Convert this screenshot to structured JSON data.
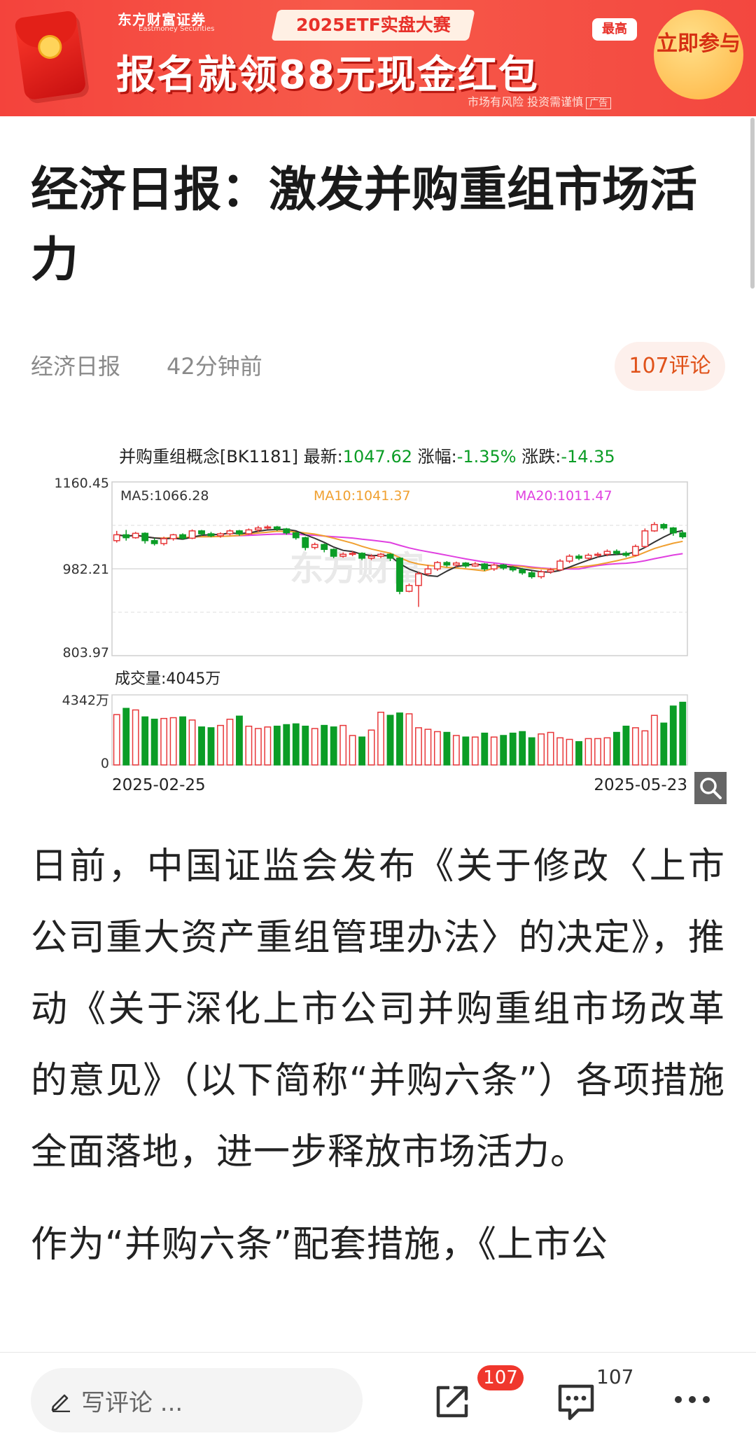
{
  "ad": {
    "brand": "东方财富证券",
    "brand_en": "Eastmoney Securities",
    "event": "2025ETF实盘大赛",
    "headline": "报名就领88元现金红包",
    "max_tag": "最高",
    "cta": "立即参与",
    "risk": "市场有风险 投资需谨慎",
    "ad_tag": "广告"
  },
  "article": {
    "title": "经济日报：激发并购重组市场活力",
    "source": "经济日报",
    "time": "42分钟前",
    "comments_label": "107评论",
    "paragraphs": [
      "日前，中国证监会发布《关于修改〈上市公司重大资产重组管理办法〉的决定》，推动《关于深化上市公司并购重组市场改革的意见》（以下简称“并购六条”）各项措施全面落地，进一步释放市场活力。",
      "作为“并购六条”配套措施，《上市公"
    ]
  },
  "chart_data": {
    "type": "candlestick",
    "header": {
      "name": "并购重组概念[BK1181]",
      "latest_label": "最新:",
      "latest": "1047.62",
      "change_pct_label": "涨幅:",
      "change_pct": "-1.35%",
      "change_label": "涨跌:",
      "change": "-14.35"
    },
    "ma": {
      "ma5": "MA5:1066.28",
      "ma10": "MA10:1041.37",
      "ma20": "MA20:1011.47"
    },
    "y_ticks": [
      "1160.45",
      "982.21",
      "803.97"
    ],
    "ylim": [
      803.97,
      1160.45
    ],
    "volume_label": "成交量:4045万",
    "volume_ticks": [
      "4342万",
      "0"
    ],
    "volume_max": 4342,
    "x_start": "2025-02-25",
    "x_end": "2025-05-23",
    "watermark": "东方财富",
    "colors": {
      "up": "#e8383a",
      "down": "#0b9d26",
      "ma5": "#333333",
      "ma10": "#f0a030",
      "ma20": "#e040e0"
    },
    "candles": [
      [
        1040,
        1052,
        1060,
        1036
      ],
      [
        1052,
        1046,
        1062,
        1040
      ],
      [
        1046,
        1055,
        1058,
        1044
      ],
      [
        1055,
        1040,
        1057,
        1034
      ],
      [
        1040,
        1034,
        1045,
        1030
      ],
      [
        1034,
        1044,
        1048,
        1030
      ],
      [
        1044,
        1052,
        1054,
        1040
      ],
      [
        1052,
        1045,
        1055,
        1042
      ],
      [
        1045,
        1060,
        1063,
        1043
      ],
      [
        1060,
        1054,
        1062,
        1050
      ],
      [
        1054,
        1050,
        1058,
        1047
      ],
      [
        1050,
        1054,
        1057,
        1046
      ],
      [
        1054,
        1060,
        1063,
        1051
      ],
      [
        1060,
        1054,
        1062,
        1050
      ],
      [
        1054,
        1062,
        1065,
        1052
      ],
      [
        1062,
        1066,
        1070,
        1058
      ],
      [
        1066,
        1068,
        1072,
        1063
      ],
      [
        1068,
        1064,
        1070,
        1060
      ],
      [
        1064,
        1056,
        1066,
        1052
      ],
      [
        1056,
        1046,
        1058,
        1042
      ],
      [
        1046,
        1026,
        1048,
        1020
      ],
      [
        1026,
        1032,
        1036,
        1022
      ],
      [
        1032,
        1022,
        1034,
        1016
      ],
      [
        1022,
        1008,
        1024,
        1004
      ],
      [
        1008,
        1012,
        1016,
        1005
      ],
      [
        1012,
        1014,
        1018,
        1008
      ],
      [
        1014,
        1004,
        1016,
        1000
      ],
      [
        1004,
        1008,
        1012,
        1000
      ],
      [
        1008,
        1012,
        1015,
        1004
      ],
      [
        1012,
        1004,
        1014,
        998
      ],
      [
        1004,
        936,
        1006,
        930
      ],
      [
        936,
        948,
        952,
        934
      ],
      [
        948,
        972,
        976,
        904
      ],
      [
        972,
        982,
        990,
        968
      ],
      [
        982,
        995,
        998,
        978
      ],
      [
        995,
        990,
        998,
        986
      ],
      [
        990,
        994,
        997,
        986
      ],
      [
        994,
        988,
        996,
        984
      ],
      [
        988,
        992,
        996,
        986
      ],
      [
        992,
        982,
        994,
        978
      ],
      [
        982,
        990,
        993,
        978
      ],
      [
        990,
        984,
        992,
        980
      ],
      [
        984,
        980,
        988,
        976
      ],
      [
        980,
        974,
        984,
        970
      ],
      [
        974,
        966,
        978,
        962
      ],
      [
        966,
        976,
        980,
        962
      ],
      [
        976,
        980,
        984,
        972
      ],
      [
        980,
        998,
        1002,
        978
      ],
      [
        998,
        1008,
        1012,
        994
      ],
      [
        1008,
        1004,
        1012,
        1000
      ],
      [
        1004,
        1010,
        1014,
        1000
      ],
      [
        1010,
        1012,
        1016,
        1006
      ],
      [
        1012,
        1018,
        1022,
        1008
      ],
      [
        1018,
        1014,
        1022,
        1010
      ],
      [
        1014,
        1010,
        1018,
        1006
      ],
      [
        1010,
        1028,
        1032,
        1008
      ],
      [
        1028,
        1060,
        1065,
        1025
      ],
      [
        1060,
        1073,
        1078,
        1058
      ],
      [
        1073,
        1066,
        1076,
        1062
      ],
      [
        1066,
        1056,
        1068,
        1050
      ],
      [
        1056,
        1048,
        1060,
        1044
      ]
    ],
    "volumes": [
      3250,
      3650,
      3550,
      3100,
      2950,
      3000,
      3050,
      3100,
      2900,
      2450,
      2400,
      2550,
      2950,
      3150,
      2500,
      2350,
      2450,
      2500,
      2600,
      2650,
      2500,
      2350,
      2550,
      2450,
      2550,
      1900,
      1800,
      2250,
      3400,
      3200,
      3350,
      3300,
      2400,
      2300,
      2150,
      2100,
      1900,
      1800,
      1800,
      2050,
      1800,
      1900,
      2050,
      2150,
      1750,
      2000,
      2100,
      1750,
      1650,
      1500,
      1700,
      1700,
      1750,
      2100,
      2500,
      2400,
      2200,
      3200,
      2700,
      3800,
      4045
    ]
  },
  "bottombar": {
    "comment_placeholder": "写评论 ...",
    "share_badge": "107",
    "comment_count": "107"
  },
  "icons": {
    "pen": "pen-icon",
    "share": "share-icon",
    "comment": "comment-icon",
    "more": "more-icon",
    "search": "search-icon"
  }
}
